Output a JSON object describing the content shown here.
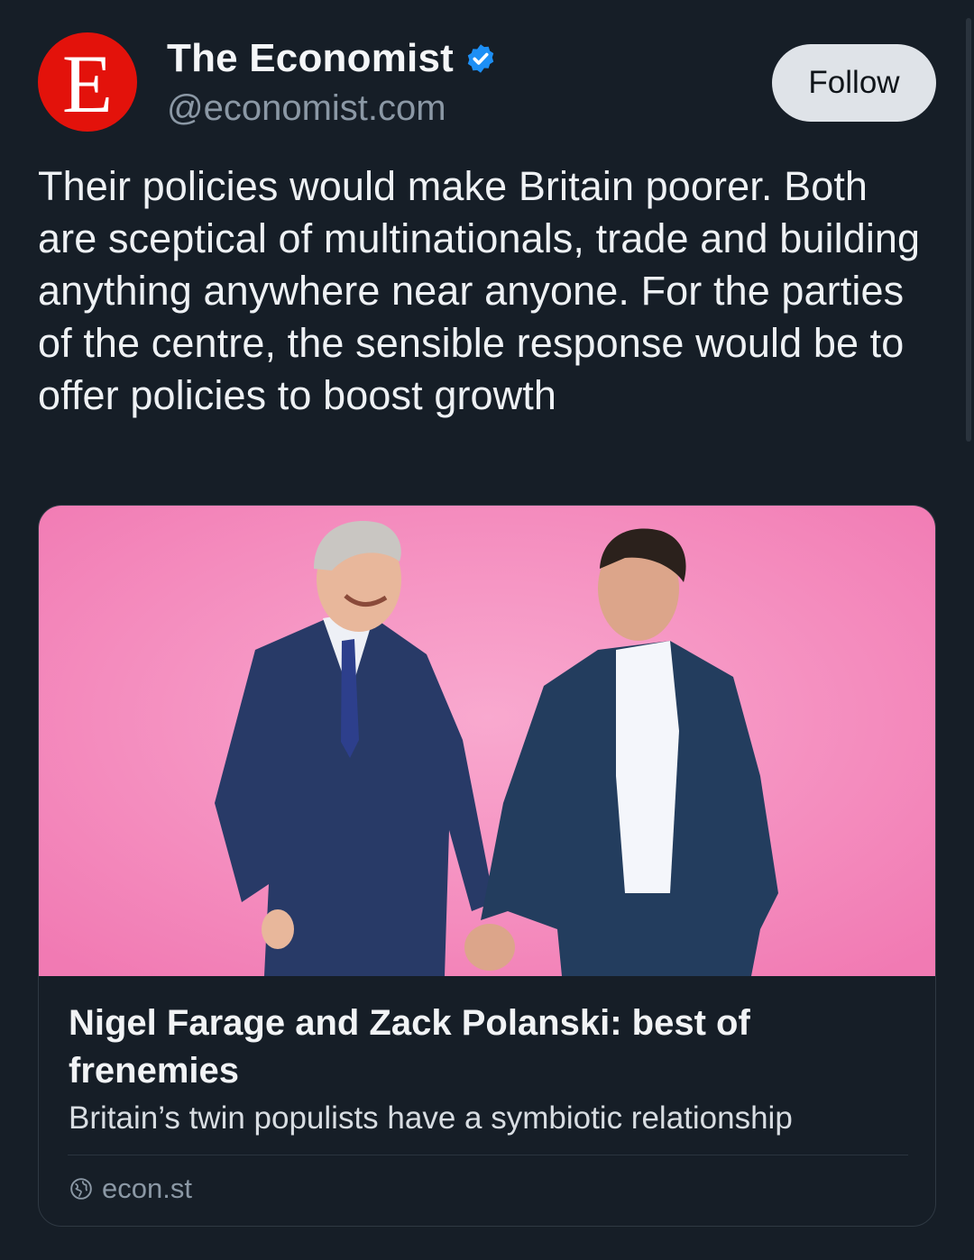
{
  "account": {
    "avatar_letter": "E",
    "avatar_color": "#e3120b",
    "name": "The Economist",
    "handle": "@economist.com",
    "verified_icon": "verified-badge-icon",
    "verified_color": "#1d8ff5"
  },
  "follow_button": {
    "label": "Follow"
  },
  "post": {
    "text": "Their policies would make Britain poorer. Both are sceptical of multinationals, trade and building anything anywhere near anyone. For the parties of the centre, the sensible response would be to offer policies to boost growth"
  },
  "link_card": {
    "image": "illustration of two men in suits holding hands on pink background",
    "image_background": "#f37fb6",
    "title": "Nigel Farage and Zack Polanski: best of frenemies",
    "description": "Britain’s twin populists have a symbiotic relationship",
    "domain": "econ.st",
    "domain_icon": "globe-icon"
  }
}
